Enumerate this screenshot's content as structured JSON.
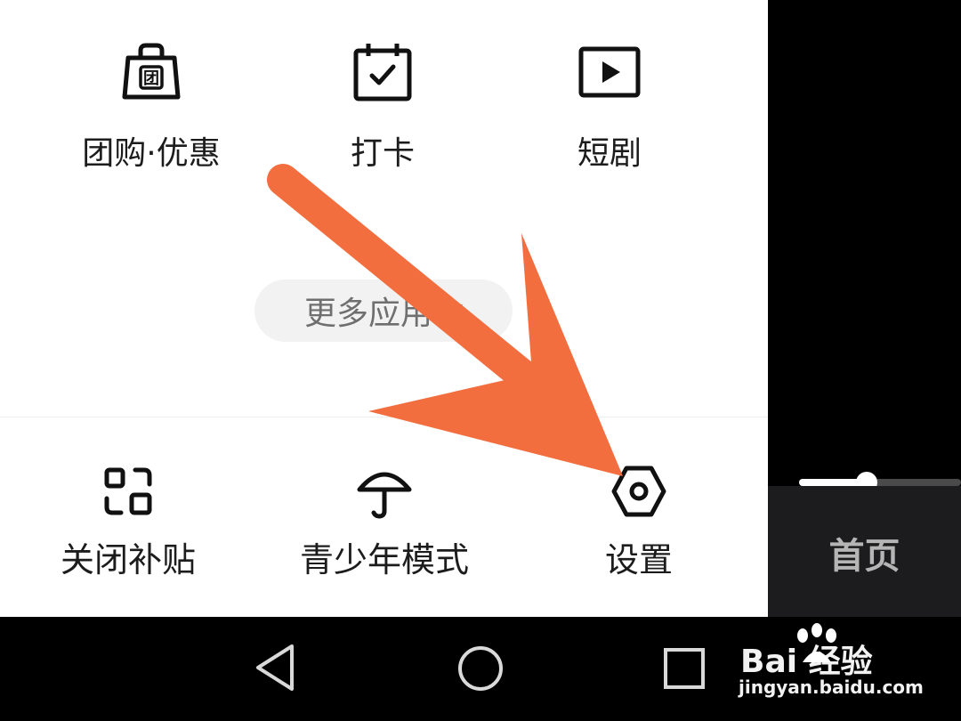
{
  "apps": [
    {
      "label": "团购·优惠",
      "icon": "shopping-bag-icon"
    },
    {
      "label": "打卡",
      "icon": "calendar-check-icon"
    },
    {
      "label": "短剧",
      "icon": "play-video-icon"
    }
  ],
  "more_apps": {
    "label": "更多应用",
    "icon": "caret-down-icon"
  },
  "tools": [
    {
      "label": "关闭补贴",
      "icon": "grid-apps-icon"
    },
    {
      "label": "青少年模式",
      "icon": "umbrella-icon"
    },
    {
      "label": "设置",
      "icon": "settings-hexagon-icon"
    }
  ],
  "right_panel": {
    "home_label": "首页",
    "slider_progress": 0.42
  },
  "nav_bar": [
    {
      "name": "back",
      "icon": "triangle-back-icon"
    },
    {
      "name": "home",
      "icon": "circle-home-icon"
    },
    {
      "name": "recents",
      "icon": "square-recents-icon"
    }
  ],
  "watermark": {
    "brand": "Bai  经验",
    "url": "jingyan.baidu.com"
  },
  "colors": {
    "annotation_arrow": "#f26e3f",
    "panel": "#ffffff",
    "home_bar": "#1c1c1e"
  }
}
